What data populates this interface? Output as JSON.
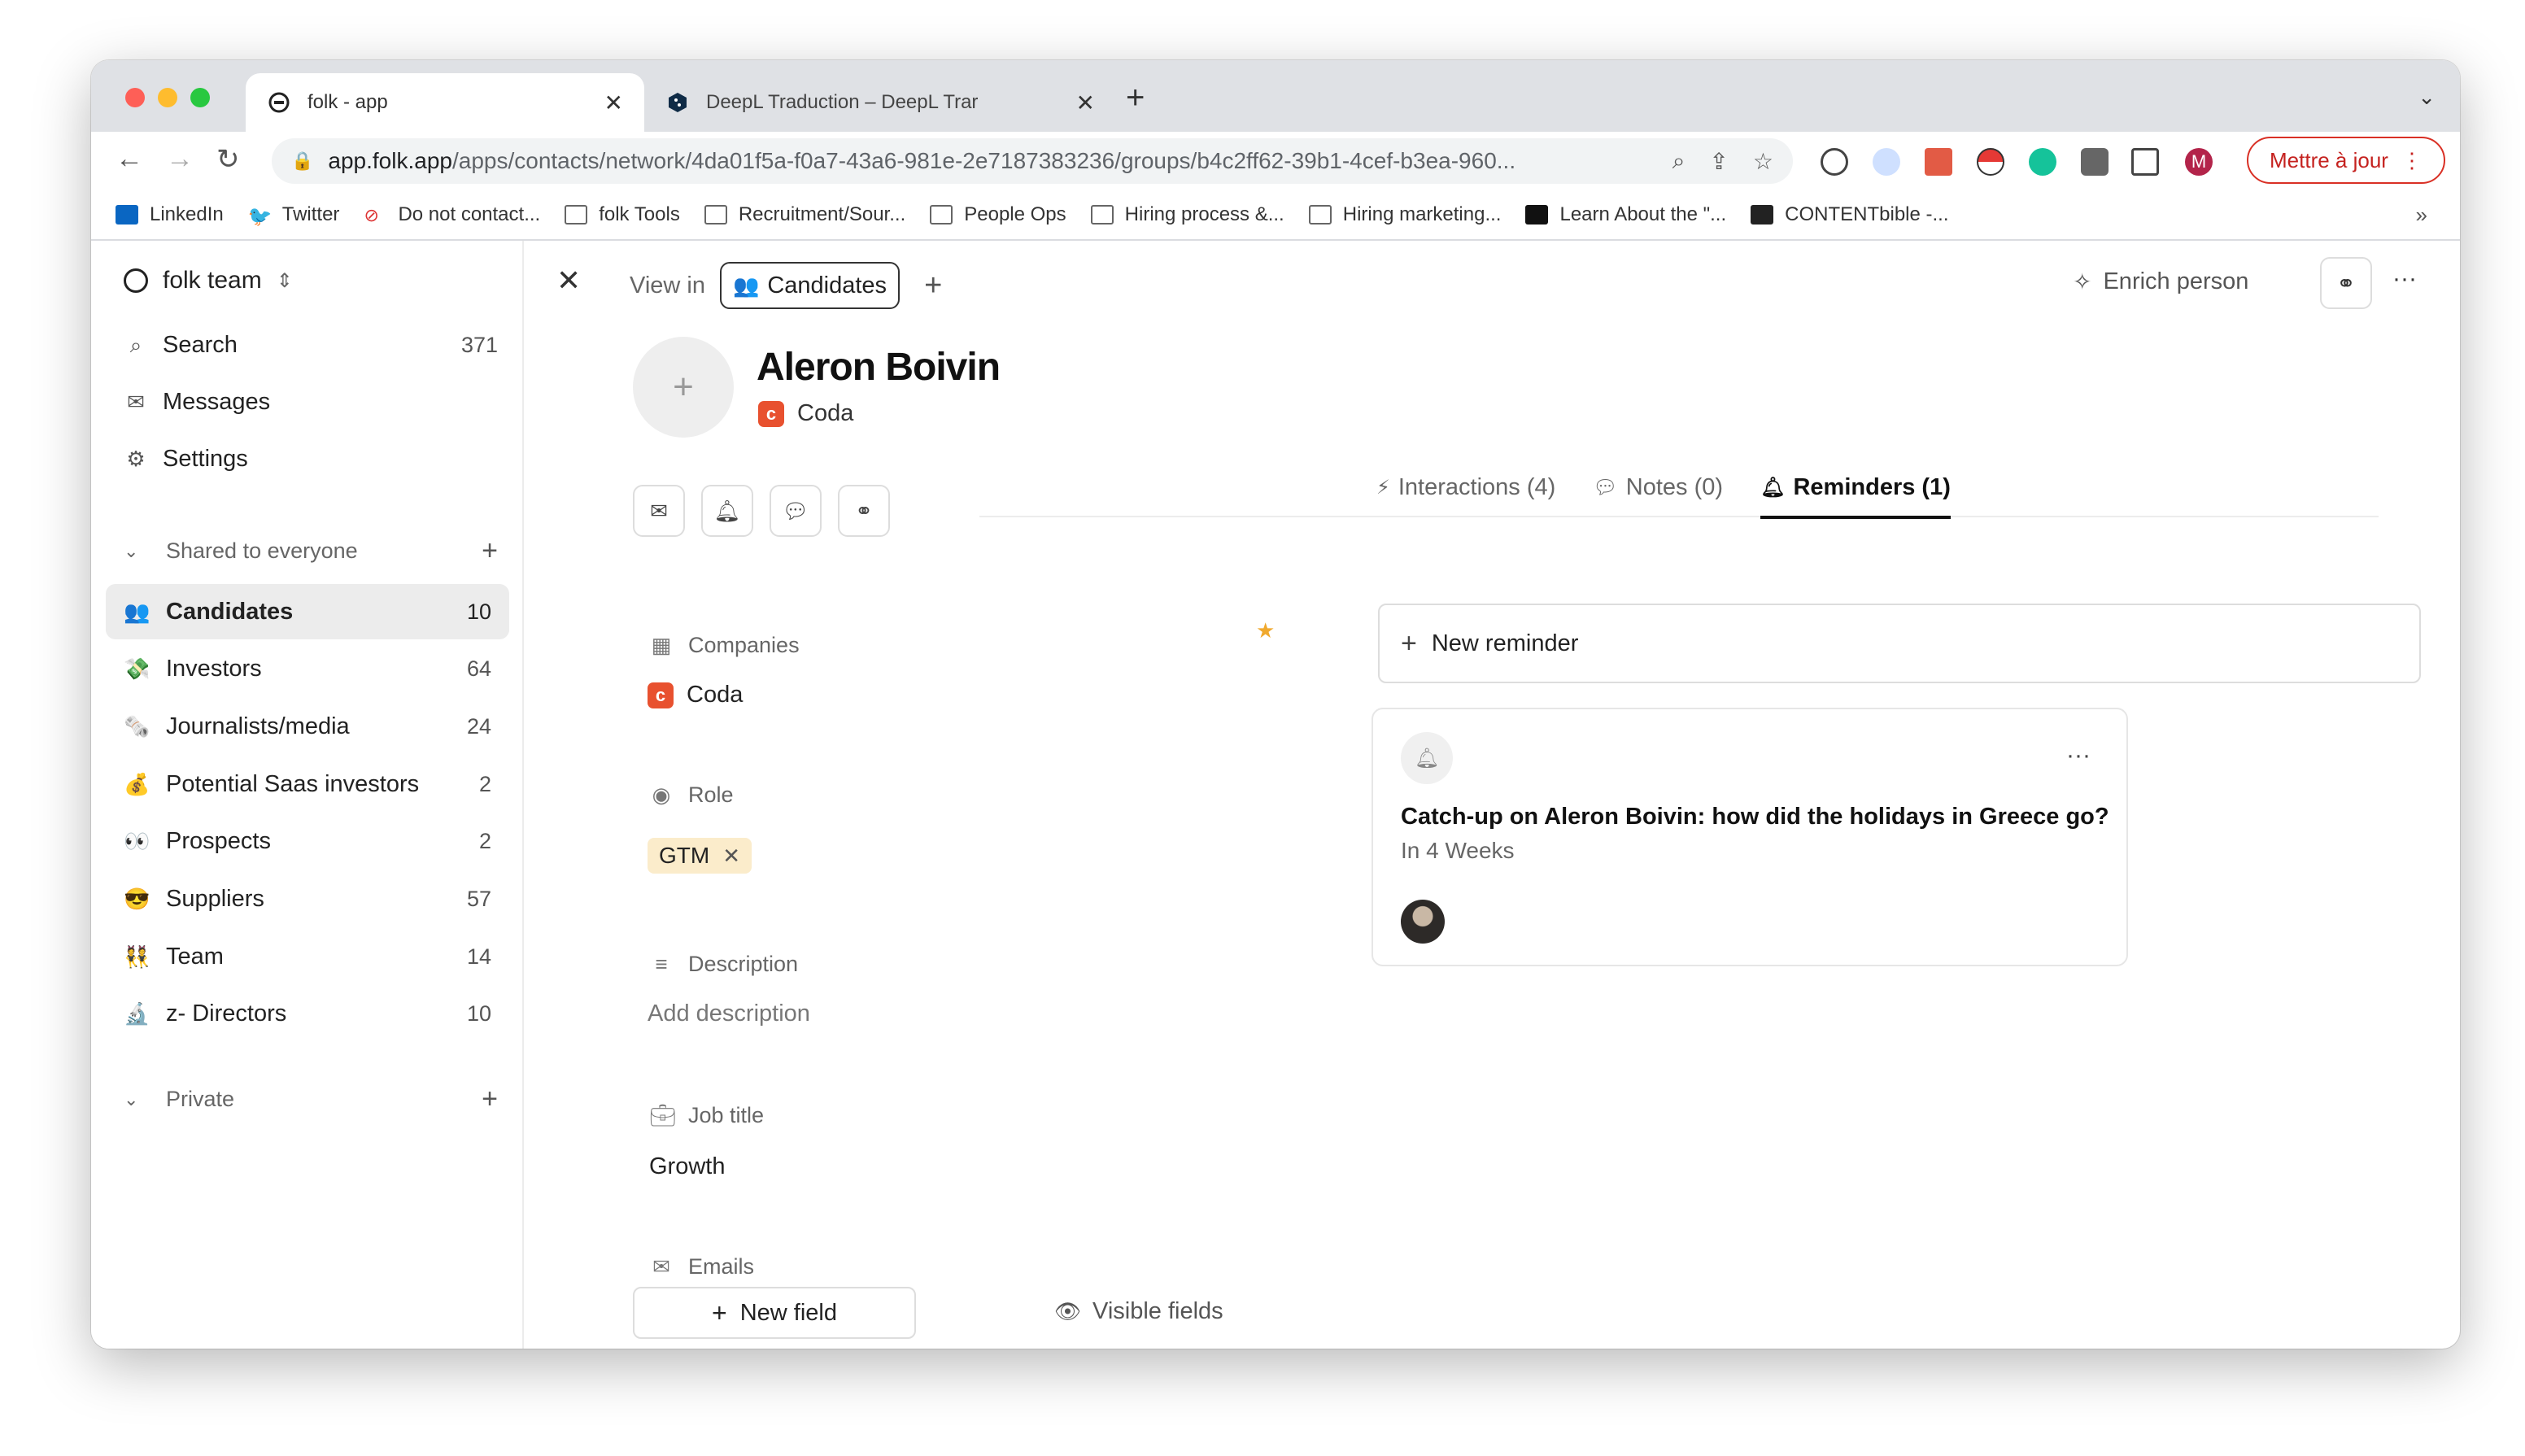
{
  "browser": {
    "tabs": [
      {
        "title": "folk - app",
        "active": true
      },
      {
        "title": "DeepL Traduction – DeepL Trar",
        "active": false
      }
    ],
    "url_host": "app.folk.app",
    "url_path": "/apps/contacts/network/4da01f5a-f0a7-43a6-981e-2e7187383236/groups/b4c2ff62-39b1-4cef-b3ea-960...",
    "update_button": "Mettre à jour",
    "profile_initial": "M",
    "bookmarks": [
      {
        "label": "LinkedIn",
        "icon": "linkedin-icon"
      },
      {
        "label": "Twitter",
        "icon": "twitter-icon"
      },
      {
        "label": "Do not contact...",
        "icon": "no-entry-icon"
      },
      {
        "label": "folk Tools",
        "icon": "folder-icon"
      },
      {
        "label": "Recruitment/Sour...",
        "icon": "folder-icon"
      },
      {
        "label": "People Ops",
        "icon": "folder-icon"
      },
      {
        "label": "Hiring process &...",
        "icon": "folder-icon"
      },
      {
        "label": "Hiring marketing...",
        "icon": "folder-icon"
      },
      {
        "label": "Learn About the \"...",
        "icon": "medium-icon"
      },
      {
        "label": "CONTENTbible -...",
        "icon": "lb-icon"
      }
    ]
  },
  "sidebar": {
    "workspace": "folk team",
    "nav": [
      {
        "label": "Search",
        "count": "371",
        "icon": "search-icon"
      },
      {
        "label": "Messages",
        "count": "",
        "icon": "mail-icon"
      },
      {
        "label": "Settings",
        "count": "",
        "icon": "gear-icon"
      }
    ],
    "shared_section": "Shared to everyone",
    "groups": [
      {
        "emoji": "👥",
        "label": "Candidates",
        "count": "10",
        "active": true
      },
      {
        "emoji": "💸",
        "label": "Investors",
        "count": "64"
      },
      {
        "emoji": "🗞️",
        "label": "Journalists/media",
        "count": "24"
      },
      {
        "emoji": "💰",
        "label": "Potential Saas investors",
        "count": "2"
      },
      {
        "emoji": "👀",
        "label": "Prospects",
        "count": "2"
      },
      {
        "emoji": "😎",
        "label": "Suppliers",
        "count": "57"
      },
      {
        "emoji": "👯",
        "label": "Team",
        "count": "14"
      },
      {
        "emoji": "🔬",
        "label": "z- Directors",
        "count": "10"
      }
    ],
    "private_section": "Private"
  },
  "main": {
    "view_in_label": "View in",
    "view_chip": {
      "emoji": "👥",
      "label": "Candidates"
    },
    "enrich_label": "Enrich person",
    "person": {
      "name": "Aleron Boivin",
      "company": "Coda"
    },
    "tabs": [
      {
        "label": "Interactions (4)",
        "icon": "bolt-icon"
      },
      {
        "label": "Notes (0)",
        "icon": "comment-icon"
      },
      {
        "label": "Reminders (1)",
        "icon": "bell-icon",
        "active": true
      }
    ],
    "fields": {
      "companies_label": "Companies",
      "companies_value": "Coda",
      "role_label": "Role",
      "role_tag": "GTM",
      "description_label": "Description",
      "description_placeholder": "Add description",
      "job_title_label": "Job title",
      "job_title_value": "Growth",
      "emails_label": "Emails"
    },
    "new_field_label": "New field",
    "visible_fields_label": "Visible fields",
    "new_reminder_label": "New reminder",
    "reminder": {
      "title": "Catch-up on Aleron Boivin: how did the holidays in Greece go?",
      "due": "In 4 Weeks"
    }
  },
  "colors": {
    "accent_update": "#d93025",
    "coda_brand": "#e8512f",
    "tag_bg": "#fbeccb",
    "star": "#f0a92e"
  }
}
